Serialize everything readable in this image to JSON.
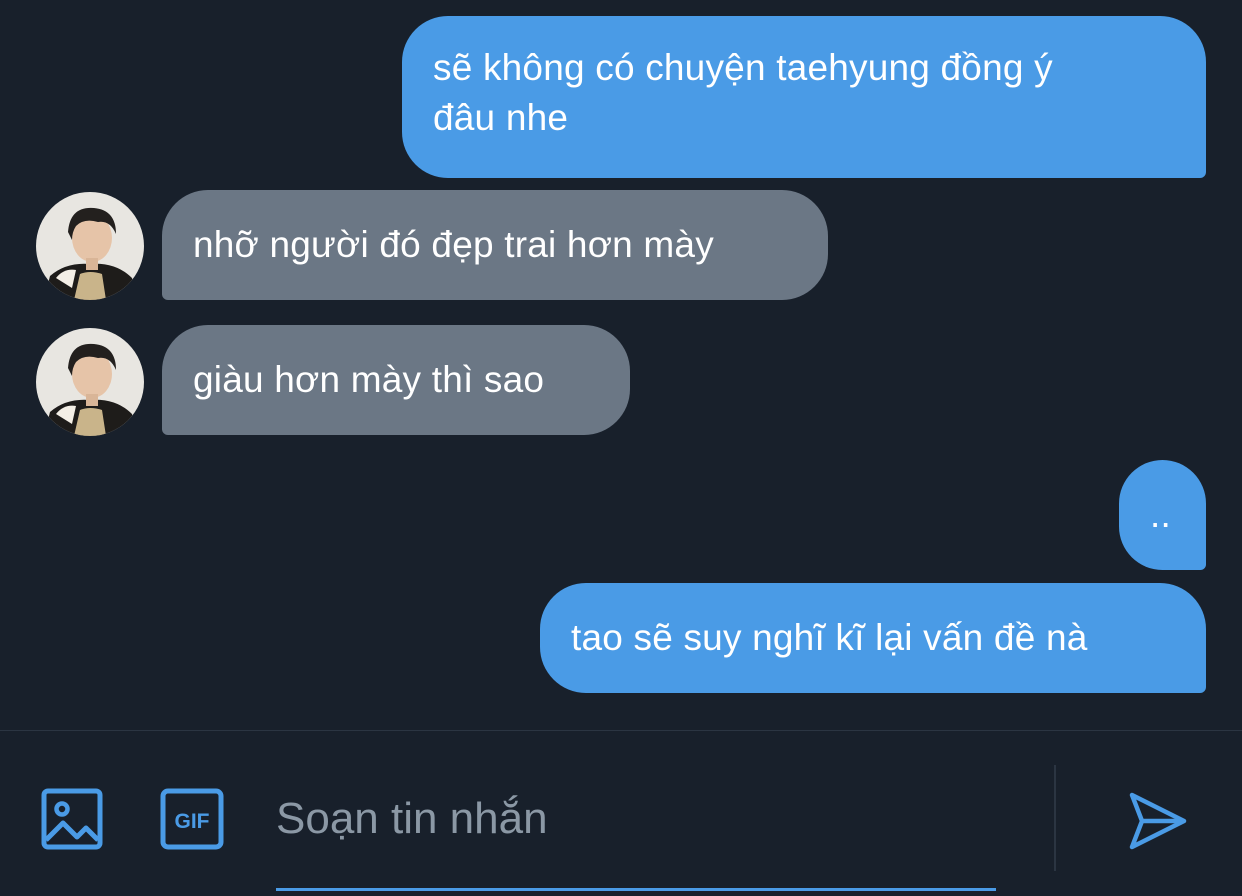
{
  "messages": [
    {
      "direction": "outgoing",
      "lines": [
        "sẽ không có chuyện taehyung đồng ý",
        "đâu nhe"
      ]
    },
    {
      "direction": "incoming",
      "text": "nhỡ người đó đẹp trai hơn mày"
    },
    {
      "direction": "incoming",
      "text": "giàu hơn mày thì sao"
    },
    {
      "direction": "outgoing",
      "text": ".."
    },
    {
      "direction": "outgoing",
      "text": "tao sẽ suy nghĩ kĩ lại vấn đề nà"
    }
  ],
  "composer": {
    "placeholder": "Soạn tin nhắn",
    "media_icon": "image-icon",
    "gif_icon": "gif-icon",
    "gif_label": "GIF",
    "send_icon": "send-icon"
  },
  "colors": {
    "background": "#18202b",
    "outgoing_bubble": "#4a9be6",
    "incoming_bubble": "#6b7785",
    "accent": "#4a9be6",
    "placeholder": "#8b98a5"
  }
}
